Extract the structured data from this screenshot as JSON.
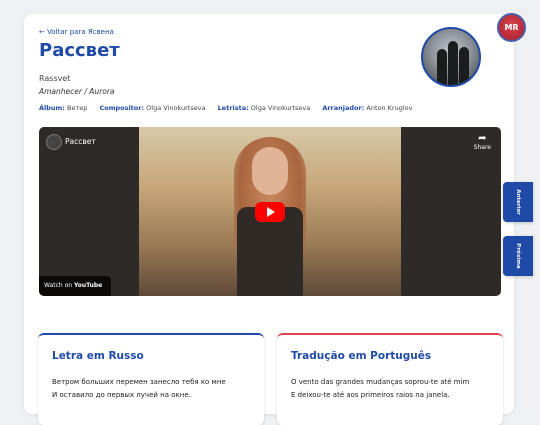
{
  "header": {
    "back_link": "← Voltar para Ясвена",
    "title": "Рассвет",
    "transliteration": "Rassvet",
    "alt_titles": "Amanhecer / Aurora"
  },
  "meta": {
    "album_label": "Álbum:",
    "album": "Ветер",
    "composer_label": "Compositor:",
    "composer": "Olga Vinokurtseva",
    "lyricist_label": "Letrista:",
    "lyricist": "Olga Vinokurtseva",
    "arranger_label": "Arranjador:",
    "arranger": "Anton Kruglov"
  },
  "video": {
    "title": "Рассвет",
    "share_label": "Share",
    "watch_on": "Watch on",
    "youtube_label": "YouTube"
  },
  "user": {
    "initials": "MR"
  },
  "nav": {
    "previous": "Anterior",
    "next": "Próxima"
  },
  "lyrics": {
    "russian_title": "Letra em Russo",
    "russian_lines": [
      "Ветром больших перемен занесло тебя ко мне",
      "И оставило до первых лучей на окне."
    ],
    "portuguese_title": "Tradução em Português",
    "portuguese_lines": [
      "O vento das grandes mudanças soprou-te até mim",
      "E deixou-te até aos primeiros raios na janela."
    ]
  },
  "colors": {
    "accent": "#1f4aa8",
    "secondary": "#d9434f"
  }
}
